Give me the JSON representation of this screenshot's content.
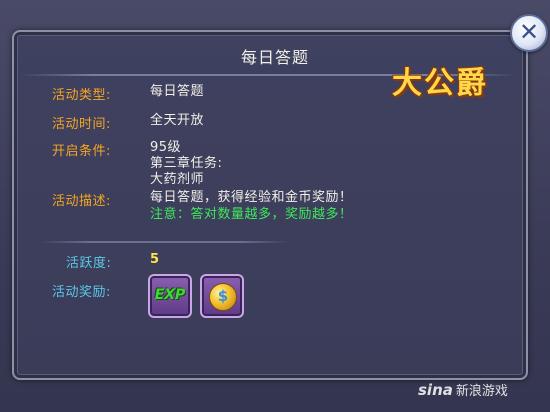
{
  "dialog": {
    "title": "每日答题",
    "logo_text": "大公爵",
    "close_glyph": "✕"
  },
  "details": {
    "type_label": "活动类型:",
    "type_value": "每日答题",
    "time_label": "活动时间:",
    "time_value": "全天开放",
    "condition_label": "开启条件:",
    "condition_lines": [
      "95级",
      "第三章任务:",
      "大药剂师"
    ],
    "desc_label": "活动描述:",
    "desc_line1": "每日答题，获得经验和金币奖励！",
    "desc_line2": "注意：答对数量越多，奖励越多！"
  },
  "activity": {
    "label": "活跃度:",
    "value": "5"
  },
  "rewards": {
    "label": "活动奖励:",
    "items": [
      {
        "name": "exp",
        "text": "EXP",
        "icon": "exp-icon"
      },
      {
        "name": "gold",
        "text": "$",
        "icon": "gold-coin-icon"
      }
    ]
  },
  "watermark": {
    "brand": "sina",
    "text": "新浪游戏"
  },
  "colors": {
    "label": "#f5a623",
    "value": "#f2f0e8",
    "note": "#3fe85a",
    "activity_label": "#5cc8e8",
    "activity_value": "#ffe34a"
  }
}
